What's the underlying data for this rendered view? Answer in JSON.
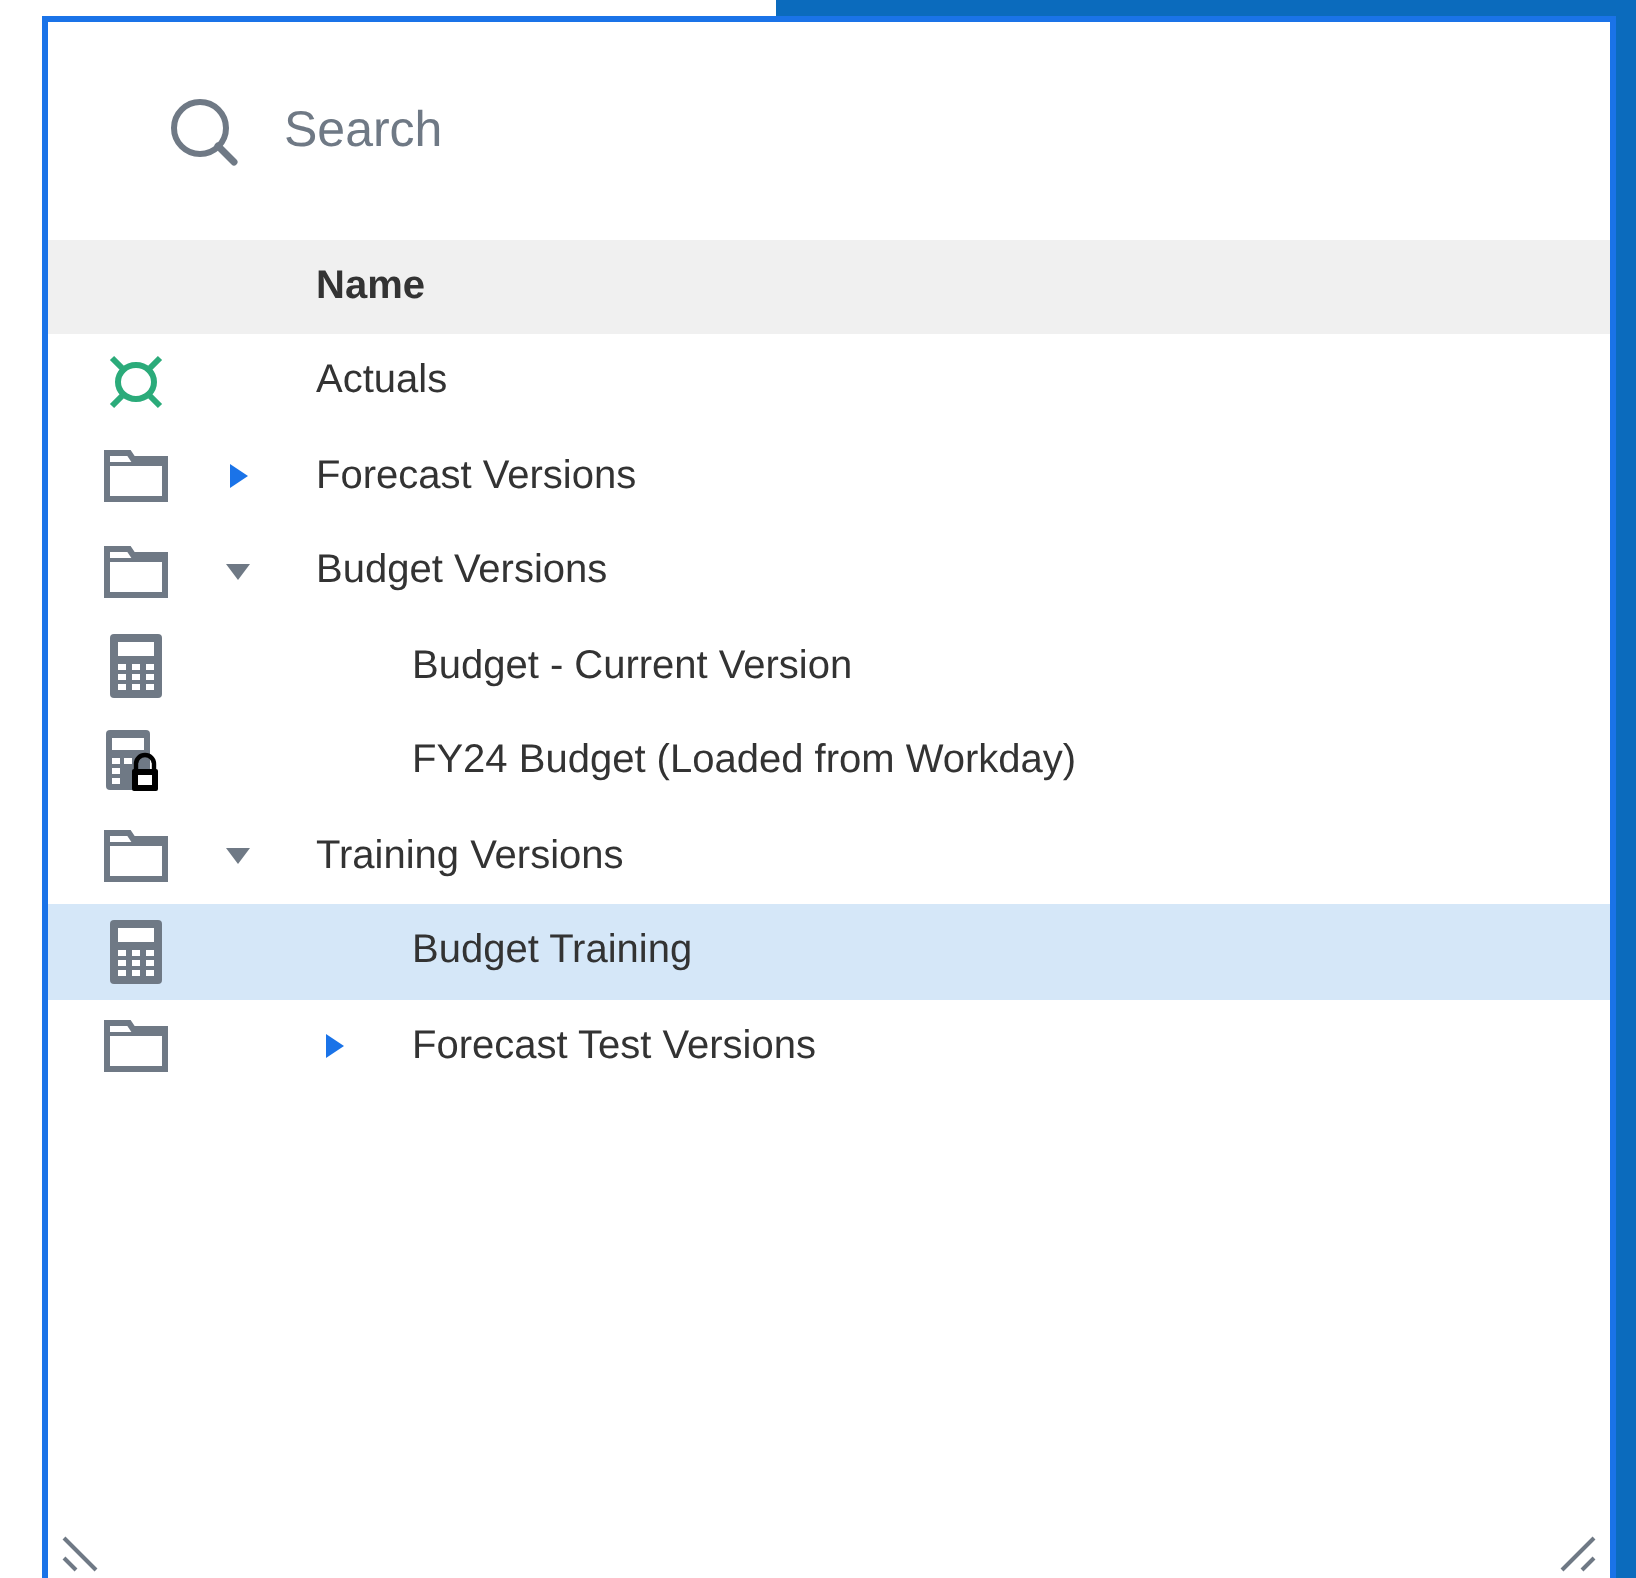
{
  "search": {
    "placeholder": "Search"
  },
  "column_header": "Name",
  "tree": [
    {
      "kind": "actuals",
      "label": "Actuals",
      "selected": false
    },
    {
      "kind": "folder",
      "label": "Forecast Versions",
      "expanded": false,
      "selected": false
    },
    {
      "kind": "folder",
      "label": "Budget Versions",
      "expanded": true,
      "selected": false,
      "children": [
        {
          "kind": "plan",
          "label": "Budget - Current Version",
          "selected": false
        },
        {
          "kind": "plan-locked",
          "label": "FY24 Budget (Loaded from Workday)",
          "selected": false
        }
      ]
    },
    {
      "kind": "folder",
      "label": "Training Versions",
      "expanded": true,
      "selected": false,
      "children": [
        {
          "kind": "plan",
          "label": "Budget Training",
          "selected": true
        },
        {
          "kind": "folder",
          "label": "Forecast Test Versions",
          "expanded": false,
          "selected": false
        }
      ]
    }
  ]
}
